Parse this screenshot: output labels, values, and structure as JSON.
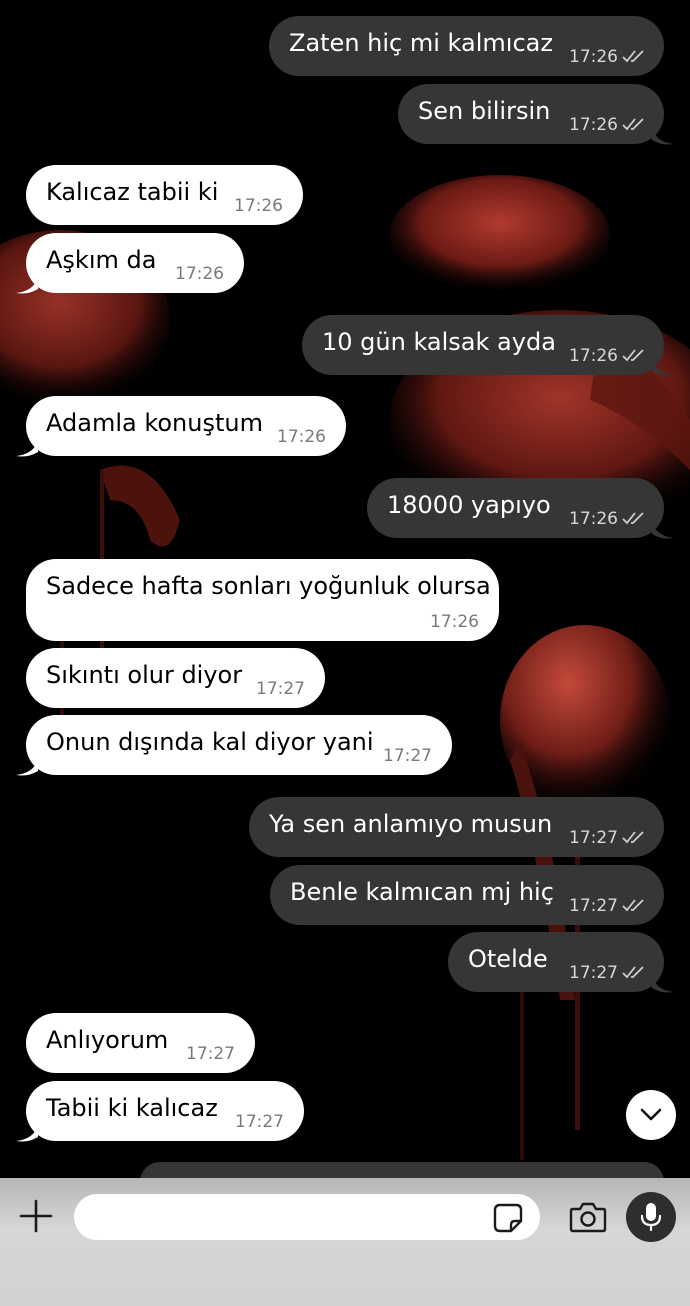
{
  "messages": [
    {
      "dir": "out",
      "text": "Zaten hiç mi kalmıcaz",
      "time": "17:26"
    },
    {
      "dir": "out",
      "text": "Sen bilirsin",
      "time": "17:26"
    },
    {
      "dir": "in",
      "text": "Kalıcaz tabii ki",
      "time": "17:26"
    },
    {
      "dir": "in",
      "text": "Aşkım da",
      "time": "17:26"
    },
    {
      "dir": "out",
      "text": "10 gün kalsak ayda",
      "time": "17:26"
    },
    {
      "dir": "in",
      "text": "Adamla konuştum",
      "time": "17:26"
    },
    {
      "dir": "out",
      "text": "18000 yapıyo",
      "time": "17:26"
    },
    {
      "dir": "in",
      "text": "Sadece hafta sonları yoğunluk olursa",
      "time": "17:26"
    },
    {
      "dir": "in",
      "text": "Sıkıntı olur diyor",
      "time": "17:27"
    },
    {
      "dir": "in",
      "text": "Onun dışında kal diyor yani",
      "time": "17:27"
    },
    {
      "dir": "out",
      "text": "Ya sen anlamıyo musun",
      "time": "17:27"
    },
    {
      "dir": "out",
      "text": "Benle kalmıcan mj hiç",
      "time": "17:27"
    },
    {
      "dir": "out",
      "text": "Otelde",
      "time": "17:27"
    },
    {
      "dir": "in",
      "text": "Anlıyorum",
      "time": "17:27"
    },
    {
      "dir": "in",
      "text": "Tabii ki kalıcaz",
      "time": "17:27"
    }
  ],
  "receipt_status": "read",
  "colors": {
    "incoming_bubble": "#ffffff",
    "outgoing_bubble": "#363636",
    "background": "#000000",
    "input_bar": "#d2d2d2"
  },
  "composer": {
    "placeholder": "",
    "icons": [
      "plus-icon",
      "sticker-icon",
      "camera-icon",
      "microphone-icon"
    ]
  },
  "scroll_button_icon": "chevron-down-icon"
}
